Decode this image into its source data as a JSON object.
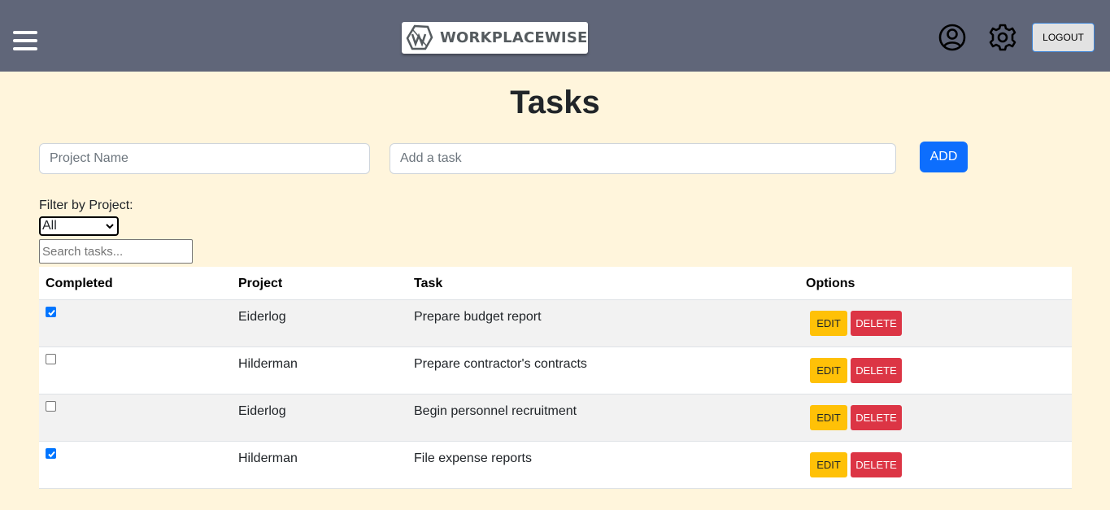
{
  "header": {
    "logo_text": "WORKPLACEWISE",
    "logout_label": "LOGOUT",
    "icons": [
      "menu-icon",
      "user-circle-icon",
      "gear-icon"
    ]
  },
  "page": {
    "title": "Tasks"
  },
  "form": {
    "project_placeholder": "Project Name",
    "project_value": "",
    "task_placeholder": "Add a task",
    "task_value": "",
    "add_label": "ADD"
  },
  "filter": {
    "label": "Filter by Project:",
    "selected": "All",
    "search_placeholder": "Search tasks..."
  },
  "table": {
    "headers": [
      "Completed",
      "Project",
      "Task",
      "Options"
    ],
    "edit_label": "EDIT",
    "delete_label": "DELETE",
    "rows": [
      {
        "completed": true,
        "project": "Eiderlog",
        "task": "Prepare budget report"
      },
      {
        "completed": false,
        "project": "Hilderman",
        "task": "Prepare contractor's contracts"
      },
      {
        "completed": false,
        "project": "Eiderlog",
        "task": "Begin personnel recruitment"
      },
      {
        "completed": true,
        "project": "Hilderman",
        "task": "File expense reports"
      }
    ]
  },
  "colors": {
    "navbar": "#606679",
    "background": "#fff5dc",
    "primary": "#0d6efd",
    "edit": "#ffc107",
    "delete": "#dc3545"
  }
}
